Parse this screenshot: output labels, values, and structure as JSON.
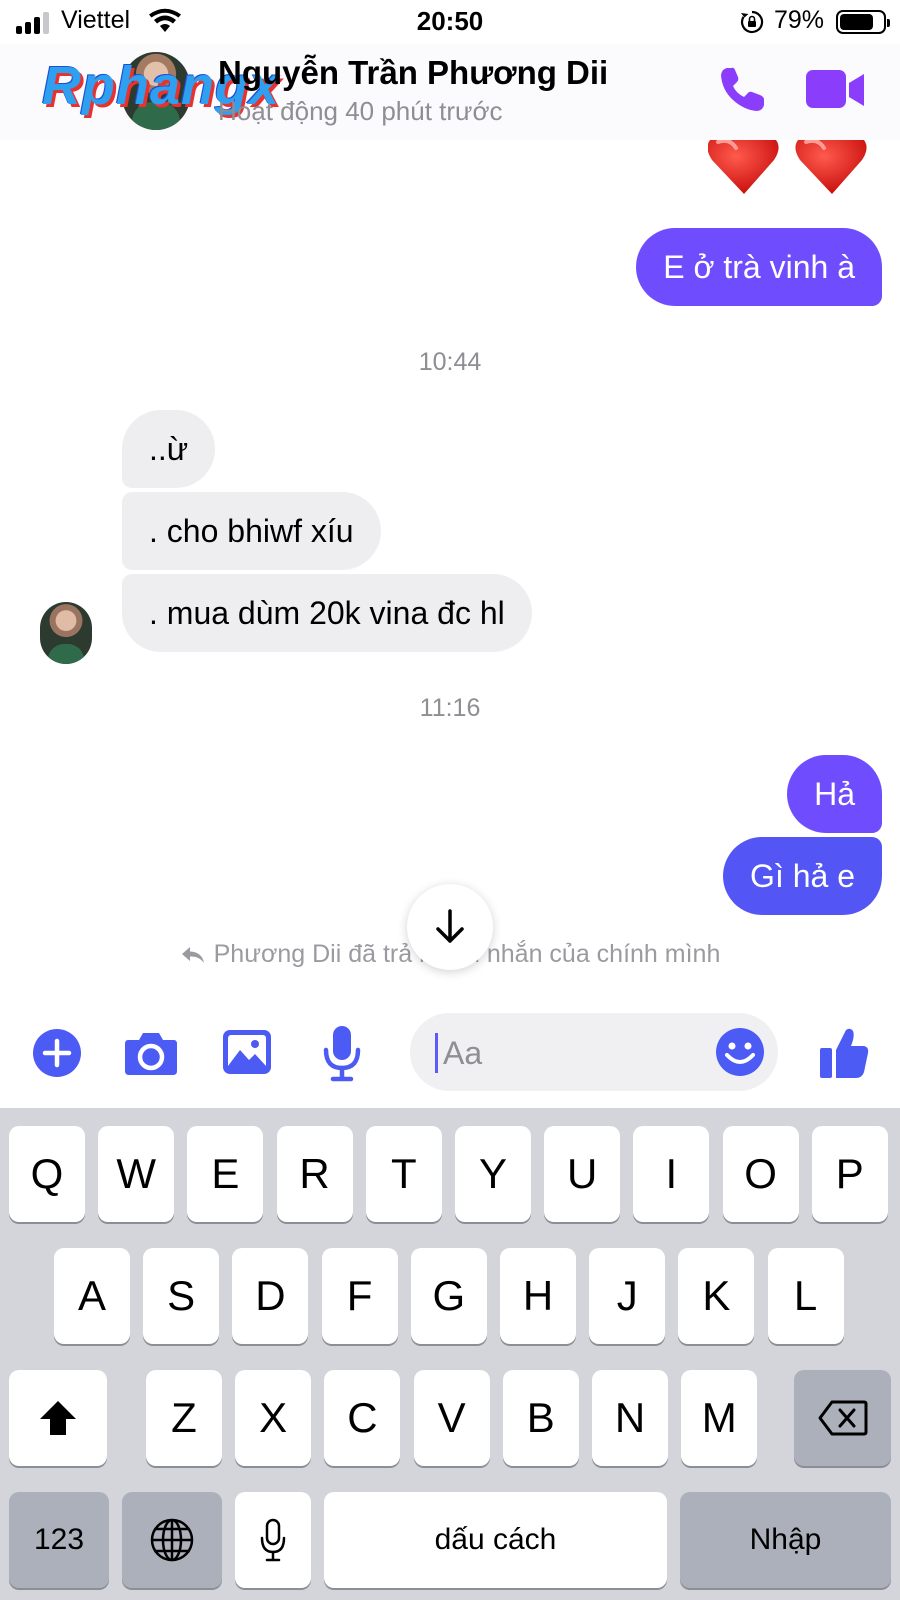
{
  "status_bar": {
    "carrier": "Viettel",
    "time": "20:50",
    "battery_percent": "79%",
    "battery_level": 0.79,
    "signal_bars_active": 3
  },
  "header": {
    "contact_name": "Nguyễn Trần Phương Dii",
    "activity_status": "Hoạt động 40 phút trước",
    "watermark": "Rphangx",
    "actions": [
      {
        "icon": "phone-icon",
        "label": "call"
      },
      {
        "icon": "video-camera-icon",
        "label": "video call"
      }
    ],
    "accent_color": "#8b3dfc"
  },
  "conversation": {
    "messages_before_1044": [
      {
        "direction": "outgoing",
        "type": "emoji",
        "text": "❤️❤️"
      },
      {
        "direction": "outgoing",
        "type": "text",
        "text": "E ở trà vinh à"
      }
    ],
    "timestamp_1": "10:44",
    "incoming_group": [
      {
        "direction": "incoming",
        "text": "..ừ"
      },
      {
        "direction": "incoming",
        "text": ". cho bhiwf xíu"
      },
      {
        "direction": "incoming",
        "text": ". mua dùm 20k vina đc hl"
      }
    ],
    "timestamp_2": "11:16",
    "outgoing_group": [
      {
        "direction": "outgoing",
        "text": "Hả"
      },
      {
        "direction": "outgoing",
        "text": "Gì hả e"
      }
    ],
    "reply_note": "Phương Dii đã trả lời tin nhắn của chính mình",
    "outgoing_bubble_colors": [
      "#6f4dff",
      "#5356f5"
    ],
    "incoming_bubble_color": "#eeeef0"
  },
  "composer": {
    "buttons": [
      "plus-circle-icon",
      "camera-icon",
      "image-icon",
      "microphone-icon"
    ],
    "placeholder": "Aa",
    "emoji_icon": "smiley-icon",
    "send_icon": "thumbs-up-icon",
    "icon_color": "#4d5bf5"
  },
  "keyboard": {
    "row1": [
      "Q",
      "W",
      "E",
      "R",
      "T",
      "Y",
      "U",
      "I",
      "O",
      "P"
    ],
    "row2": [
      "A",
      "S",
      "D",
      "F",
      "G",
      "H",
      "J",
      "K",
      "L"
    ],
    "row3": [
      "Z",
      "X",
      "C",
      "V",
      "B",
      "N",
      "M"
    ],
    "shift_icon": "shift-arrow-icon",
    "backspace_icon": "backspace-icon",
    "numbers_label": "123",
    "globe_icon": "globe-icon",
    "dictation_icon": "microphone-icon",
    "space_label": "dấu cách",
    "return_label": "Nhập"
  }
}
